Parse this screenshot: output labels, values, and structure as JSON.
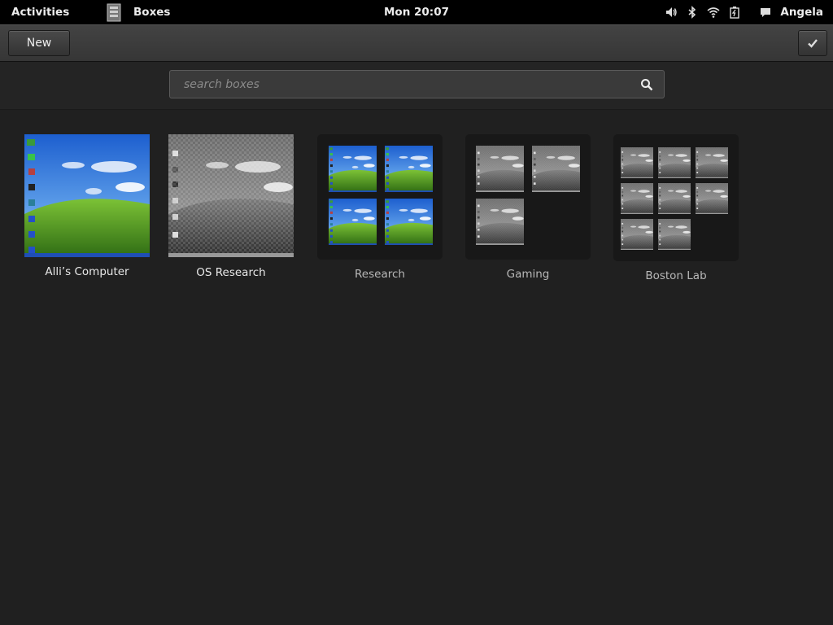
{
  "top_bar": {
    "activities_label": "Activities",
    "app_name": "Boxes",
    "app_icon": "boxes-app-icon",
    "clock": "Mon 20:07",
    "status_icons": [
      "volume-icon",
      "bluetooth-icon",
      "wifi-icon",
      "battery-icon",
      "chat-icon"
    ],
    "user_name": "Angela"
  },
  "toolbar": {
    "new_label": "New",
    "select_icon": "checkmark-icon"
  },
  "search": {
    "placeholder": "search boxes",
    "value": "",
    "icon": "search-icon"
  },
  "items": [
    {
      "label": "Alli’s Computer",
      "type": "box",
      "thumbnail": "color desktop"
    },
    {
      "label": "OS Research",
      "type": "box",
      "thumbnail": "grayscale desktop"
    },
    {
      "label": "Research",
      "type": "collection",
      "members": 4,
      "thumbnail": "color desktop"
    },
    {
      "label": "Gaming",
      "type": "collection",
      "members": 3,
      "thumbnail": "grayscale desktop"
    },
    {
      "label": "Boston Lab",
      "type": "collection",
      "members": 8,
      "thumbnail": "grayscale desktop"
    }
  ],
  "colors": {
    "background": "#202020",
    "top_bar": "#000000",
    "toolbar": "#3c3c3c",
    "sky_color": "#2f72d6",
    "grass_color": "#5d9e2a"
  }
}
